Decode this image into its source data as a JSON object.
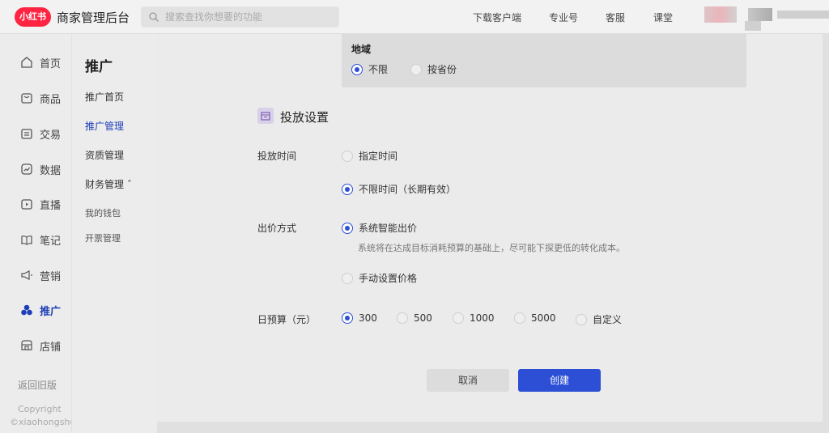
{
  "header": {
    "logo_text": "小红书",
    "app_title": "商家管理后台",
    "search_placeholder": "搜索查找你想要的功能",
    "links": [
      "下载客户端",
      "专业号",
      "客服",
      "课堂"
    ]
  },
  "leftnav": {
    "items": [
      {
        "label": "首页",
        "icon": "home-icon"
      },
      {
        "label": "商品",
        "icon": "product-icon"
      },
      {
        "label": "交易",
        "icon": "trade-icon"
      },
      {
        "label": "数据",
        "icon": "data-icon"
      },
      {
        "label": "直播",
        "icon": "live-icon"
      },
      {
        "label": "笔记",
        "icon": "notes-icon"
      },
      {
        "label": "营销",
        "icon": "marketing-icon"
      },
      {
        "label": "推广",
        "icon": "promotion-icon",
        "active": true
      },
      {
        "label": "店铺",
        "icon": "store-icon"
      }
    ],
    "back_old": "返回旧版",
    "copyright": "Copyright",
    "copyright_owner": "©xiaohongshu"
  },
  "subnav": {
    "title": "推广",
    "items": [
      "推广首页",
      "推广管理",
      "资质管理",
      "财务管理 ˆ",
      "我的钱包",
      "开票管理"
    ]
  },
  "form": {
    "region": {
      "title": "地域",
      "options": [
        "不限",
        "按省份"
      ],
      "selected": "不限"
    },
    "section_title": "投放设置",
    "time": {
      "label": "投放时间",
      "options": [
        "指定时间",
        "不限时间（长期有效）"
      ],
      "selected": "不限时间（长期有效）"
    },
    "bid": {
      "label": "出价方式",
      "options": [
        "系统智能出价",
        "手动设置价格"
      ],
      "selected": "系统智能出价",
      "hint": "系统将在达成目标消耗预算的基础上，尽可能下探更低的转化成本。"
    },
    "budget": {
      "label": "日预算（元）",
      "options": [
        "300",
        "500",
        "1000",
        "5000",
        "自定义"
      ],
      "selected": "300"
    },
    "cancel_label": "取消",
    "create_label": "创建"
  },
  "colors": {
    "brand": "#ff2442",
    "accent": "#2c4fd6"
  }
}
